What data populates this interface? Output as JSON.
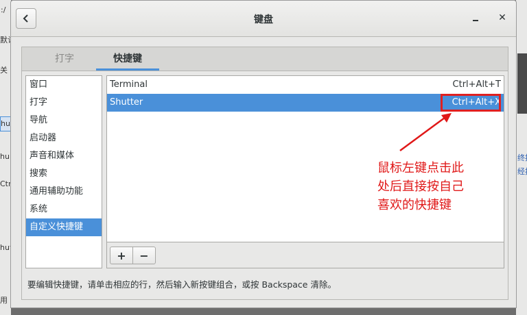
{
  "window": {
    "title": "键盘"
  },
  "tabs": [
    {
      "label": "打字",
      "active": false
    },
    {
      "label": "快捷键",
      "active": true
    }
  ],
  "categories": [
    {
      "label": "窗口",
      "selected": false
    },
    {
      "label": "打字",
      "selected": false
    },
    {
      "label": "导航",
      "selected": false
    },
    {
      "label": "启动器",
      "selected": false
    },
    {
      "label": "声音和媒体",
      "selected": false
    },
    {
      "label": "搜索",
      "selected": false
    },
    {
      "label": "通用辅助功能",
      "selected": false
    },
    {
      "label": "系统",
      "selected": false
    },
    {
      "label": "自定义快捷键",
      "selected": true
    }
  ],
  "shortcuts": [
    {
      "name": "Terminal",
      "accel": "Ctrl+Alt+T",
      "selected": false
    },
    {
      "name": "Shutter",
      "accel": "Ctrl+Alt+X",
      "selected": true
    }
  ],
  "toolbar": {
    "add_label": "+",
    "remove_label": "−"
  },
  "help_text": "要编辑快捷键，请单击相应的行，然后输入新按键组合，或按 Backspace 清除。",
  "annotation": {
    "lines": [
      "鼠标左键点击此",
      "处后直接按自己",
      "喜欢的快捷键"
    ],
    "color": "#e01818"
  },
  "background_fragments": {
    "left": [
      ":/",
      "默认",
      "关",
      "hu",
      "hu",
      "Ctr",
      "hutt",
      "用"
    ],
    "right": [
      "终按",
      "经按"
    ]
  },
  "colors": {
    "accent": "#4a90d9",
    "annotation": "#e01818"
  }
}
